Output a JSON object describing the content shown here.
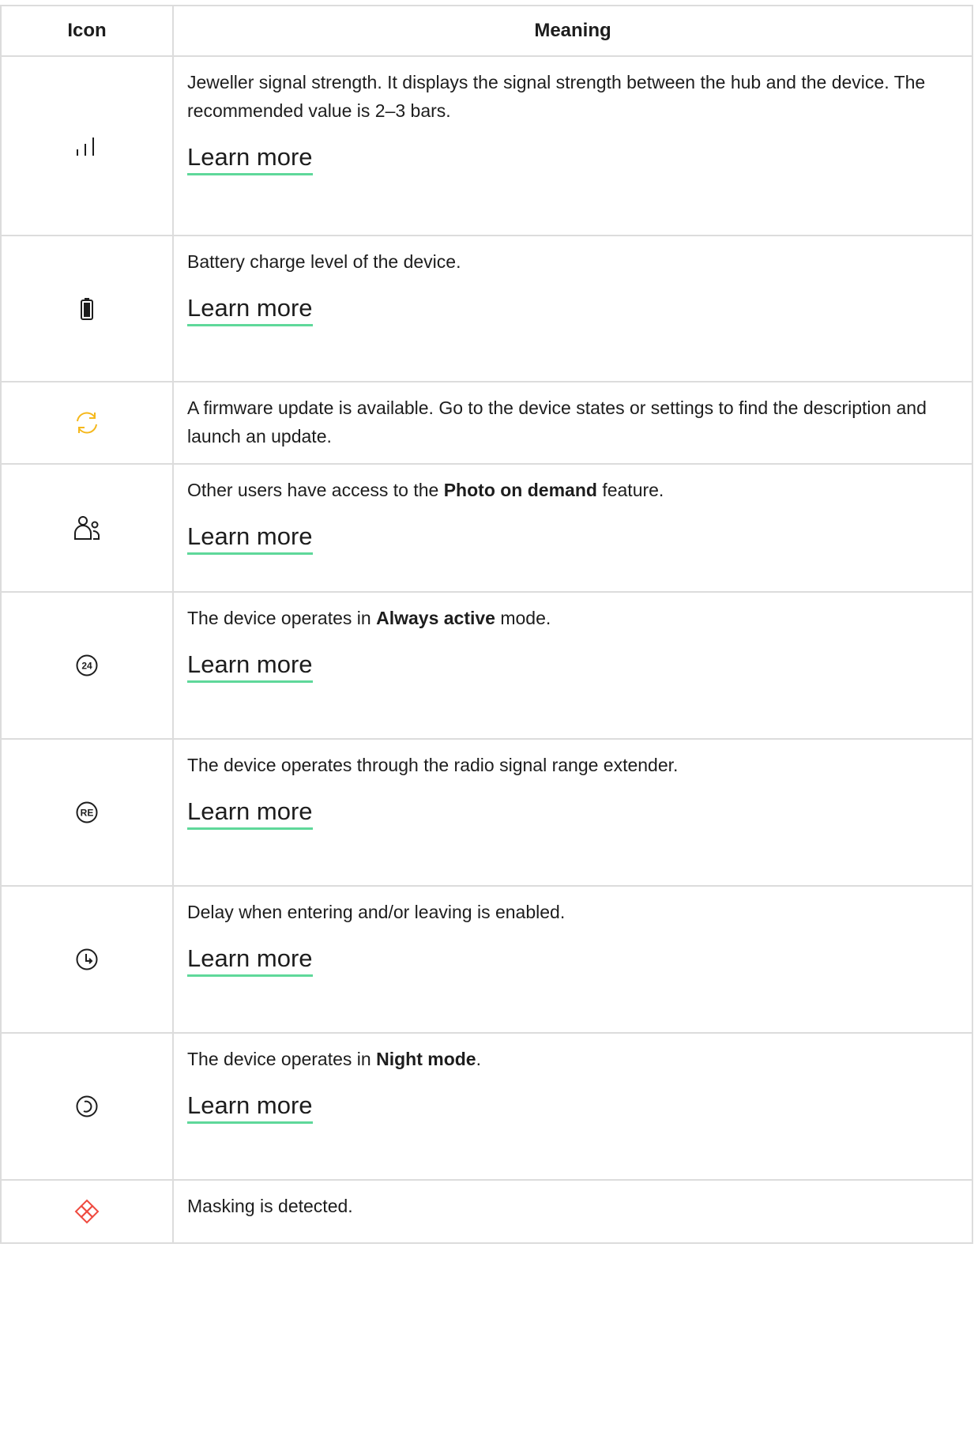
{
  "table": {
    "header": {
      "icon": "Icon",
      "meaning": "Meaning"
    },
    "rows": [
      {
        "icon": "signal-strength-icon",
        "text": "Jeweller signal strength. It displays the signal strength between the hub and the device. The recommended value is 2–3 bars.",
        "link": "Learn more"
      },
      {
        "icon": "battery-icon",
        "text": "Battery charge level of the device.",
        "link": "Learn more"
      },
      {
        "icon": "firmware-update-icon",
        "text": "A firmware update is available. Go to the device states or settings to find the description and launch an update."
      },
      {
        "icon": "users-icon",
        "text_before": "Other users have access to the ",
        "text_bold": "Photo on demand",
        "text_after": " feature.",
        "link": "Learn more"
      },
      {
        "icon": "always-active-24-icon",
        "icon_label": "24",
        "text_before": "The device operates in ",
        "text_bold": "Always active",
        "text_after": " mode.",
        "link": "Learn more"
      },
      {
        "icon": "range-extender-icon",
        "icon_label": "RE",
        "text": "The device operates through the radio signal range extender.",
        "link": "Learn more"
      },
      {
        "icon": "delay-clock-icon",
        "text": "Delay when entering and/or leaving is enabled.",
        "link": "Learn more"
      },
      {
        "icon": "night-mode-icon",
        "text_before": "The device operates in ",
        "text_bold": "Night mode",
        "text_after": ".",
        "link": "Learn more"
      },
      {
        "icon": "masking-detected-icon",
        "text": "Masking is detected."
      }
    ]
  },
  "colors": {
    "text": "#1d1d1d",
    "border": "#dcdcdc",
    "link_underline": "#5fd89a",
    "update_icon": "#f5b81c",
    "masking_icon": "#ef4a3f"
  }
}
